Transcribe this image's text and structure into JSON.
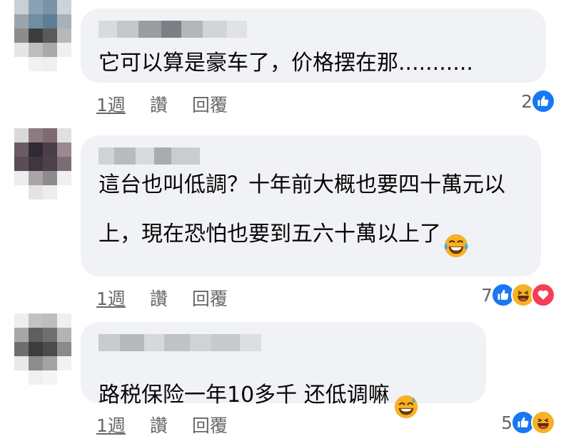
{
  "colors": {
    "bubble": "#f0f2f5",
    "text": "#050505",
    "meta": "#65676b",
    "like_blue": "#1877f2",
    "haha_yellow": "#f7b125",
    "love_red": "#f33e58"
  },
  "comments": [
    {
      "text": "它可以算是豪车了，价格摆在那...........",
      "time": "1週",
      "like_label": "讚",
      "reply_label": "回覆",
      "reaction_count": "2",
      "reactions": [
        "like-icon"
      ]
    },
    {
      "text": "這台也叫低調？十年前大概也要四十萬元以上，現在恐怕也要到五六十萬以上了",
      "emoji": "tears-of-joy-emoji",
      "time": "1週",
      "like_label": "讚",
      "reply_label": "回覆",
      "reaction_count": "7",
      "reactions": [
        "like-icon",
        "haha-icon",
        "love-icon"
      ]
    },
    {
      "text": "路税保险一年10多千 还低调嘛",
      "emoji": "sweat-smile-emoji",
      "time": "1週",
      "like_label": "讚",
      "reply_label": "回覆",
      "reaction_count": "5",
      "reactions": [
        "like-icon",
        "haha-icon"
      ]
    }
  ]
}
